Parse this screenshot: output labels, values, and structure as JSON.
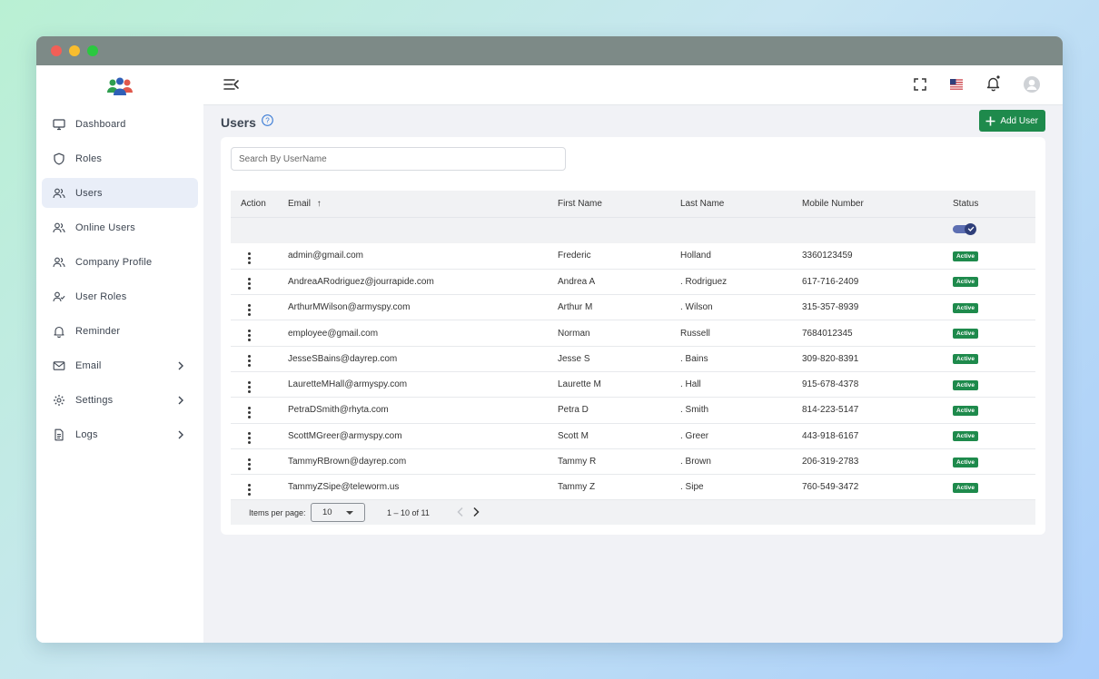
{
  "window": {
    "controls": [
      {
        "name": "close",
        "color": "#f25f57"
      },
      {
        "name": "minimize",
        "color": "#f8bd2e"
      },
      {
        "name": "maximize",
        "color": "#2bc840"
      }
    ]
  },
  "sidebar": {
    "logo_icon": "team-logo-icon",
    "items": [
      {
        "label": "Dashboard",
        "icon": "monitor-icon",
        "active": false,
        "expandable": false
      },
      {
        "label": "Roles",
        "icon": "shield-icon",
        "active": false,
        "expandable": false
      },
      {
        "label": "Users",
        "icon": "users-icon",
        "active": true,
        "expandable": false
      },
      {
        "label": "Online Users",
        "icon": "users-icon",
        "active": false,
        "expandable": false
      },
      {
        "label": "Company Profile",
        "icon": "users-icon",
        "active": false,
        "expandable": false
      },
      {
        "label": "User Roles",
        "icon": "user-check-icon",
        "active": false,
        "expandable": false
      },
      {
        "label": "Reminder",
        "icon": "bell-icon",
        "active": false,
        "expandable": false
      },
      {
        "label": "Email",
        "icon": "mail-icon",
        "active": false,
        "expandable": true
      },
      {
        "label": "Settings",
        "icon": "gear-icon",
        "active": false,
        "expandable": true
      },
      {
        "label": "Logs",
        "icon": "document-icon",
        "active": false,
        "expandable": true
      }
    ]
  },
  "topbar": {
    "icons": [
      "menu-collapse-icon",
      "fullscreen-icon",
      "us-flag-icon",
      "bell-icon",
      "avatar-icon"
    ]
  },
  "page": {
    "title": "Users",
    "help_icon": "help-circle-icon",
    "add_button": "Add User"
  },
  "search": {
    "placeholder": "Search By UserName",
    "value": ""
  },
  "table": {
    "columns": [
      "Action",
      "Email",
      "First Name",
      "Last Name",
      "Mobile Number",
      "Status"
    ],
    "sort_indicator": "↑",
    "status_filter_on": true,
    "rows": [
      {
        "email": "admin@gmail.com",
        "first": "Frederic",
        "last": "Holland",
        "mobile": "3360123459",
        "status": "Active"
      },
      {
        "email": "AndreaARodriguez@jourrapide.com",
        "first": "Andrea A",
        "last": ". Rodriguez",
        "mobile": "617-716-2409",
        "status": "Active"
      },
      {
        "email": "ArthurMWilson@armyspy.com",
        "first": "Arthur M",
        "last": ". Wilson",
        "mobile": "315-357-8939",
        "status": "Active"
      },
      {
        "email": "employee@gmail.com",
        "first": "Norman",
        "last": "Russell",
        "mobile": "7684012345",
        "status": "Active"
      },
      {
        "email": "JesseSBains@dayrep.com",
        "first": "Jesse S",
        "last": ". Bains",
        "mobile": "309-820-8391",
        "status": "Active"
      },
      {
        "email": "LauretteMHall@armyspy.com",
        "first": "Laurette M",
        "last": ". Hall",
        "mobile": "915-678-4378",
        "status": "Active"
      },
      {
        "email": "PetraDSmith@rhyta.com",
        "first": "Petra D",
        "last": ". Smith",
        "mobile": "814-223-5147",
        "status": "Active"
      },
      {
        "email": "ScottMGreer@armyspy.com",
        "first": "Scott M",
        "last": ". Greer",
        "mobile": "443-918-6167",
        "status": "Active"
      },
      {
        "email": "TammyRBrown@dayrep.com",
        "first": "Tammy R",
        "last": ". Brown",
        "mobile": "206-319-2783",
        "status": "Active"
      },
      {
        "email": "TammyZSipe@teleworm.us",
        "first": "Tammy Z",
        "last": ". Sipe",
        "mobile": "760-549-3472",
        "status": "Active"
      }
    ]
  },
  "paginator": {
    "items_label": "Items per page:",
    "page_size": "10",
    "range": "1 – 10 of 11"
  },
  "colors": {
    "accent_green": "#1e8a4c",
    "active_nav_bg": "#e9eef8",
    "toggle_blue": "#2f3f7a"
  }
}
